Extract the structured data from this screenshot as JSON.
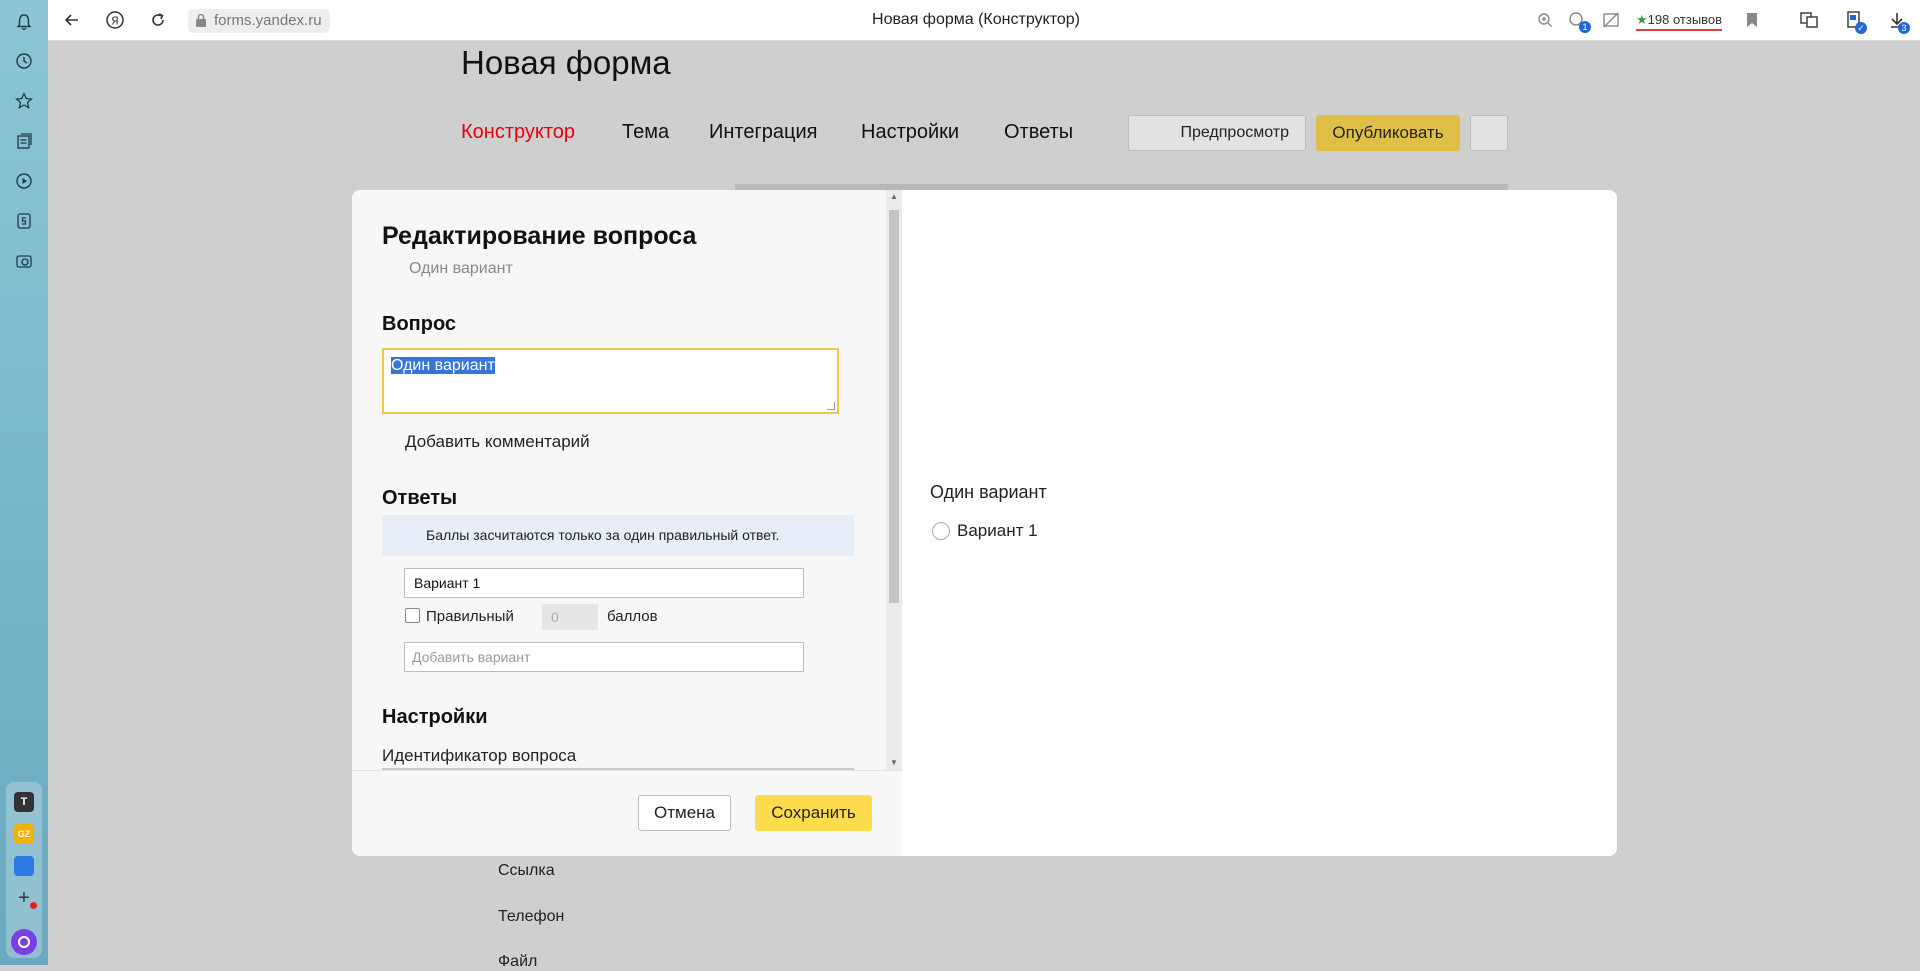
{
  "browser": {
    "url": "forms.yandex.ru",
    "tab_title": "Новая форма (Конструктор)",
    "reviews": "198 отзывов",
    "badge_extensions": "1",
    "badge_downloads": "3"
  },
  "sidebar_apps": [
    {
      "label": "T",
      "color": "#333333"
    },
    {
      "label": "GZ",
      "color": "#f2b200"
    },
    {
      "label": "",
      "color": "#2c7be5"
    }
  ],
  "page": {
    "title": "Новая форма",
    "tabs": [
      {
        "label": "Конструктор"
      },
      {
        "label": "Тема"
      },
      {
        "label": "Интеграция"
      },
      {
        "label": "Настройки"
      },
      {
        "label": "Ответы"
      }
    ],
    "preview_label": "Предпросмотр",
    "publish_label": "Опубликовать",
    "bg_fields": [
      "Ссылка",
      "Телефон",
      "Файл"
    ]
  },
  "modal": {
    "title": "Редактирование вопроса",
    "subtitle": "Один вариант",
    "question_heading": "Вопрос",
    "question_value": "Один вариант",
    "add_comment": "Добавить комментарий",
    "answers_heading": "Ответы",
    "info_text": "Баллы засчитаются только за один правильный ответ.",
    "variant_value": "Вариант 1",
    "correct_label": "Правильный",
    "points_value": "0",
    "points_label": "баллов",
    "add_variant_placeholder": "Добавить вариант",
    "settings_heading": "Настройки",
    "question_id_label": "Идентификатор вопроса",
    "cancel_label": "Отмена",
    "save_label": "Сохранить"
  },
  "preview": {
    "question": "Один вариант",
    "variant": "Вариант 1"
  }
}
